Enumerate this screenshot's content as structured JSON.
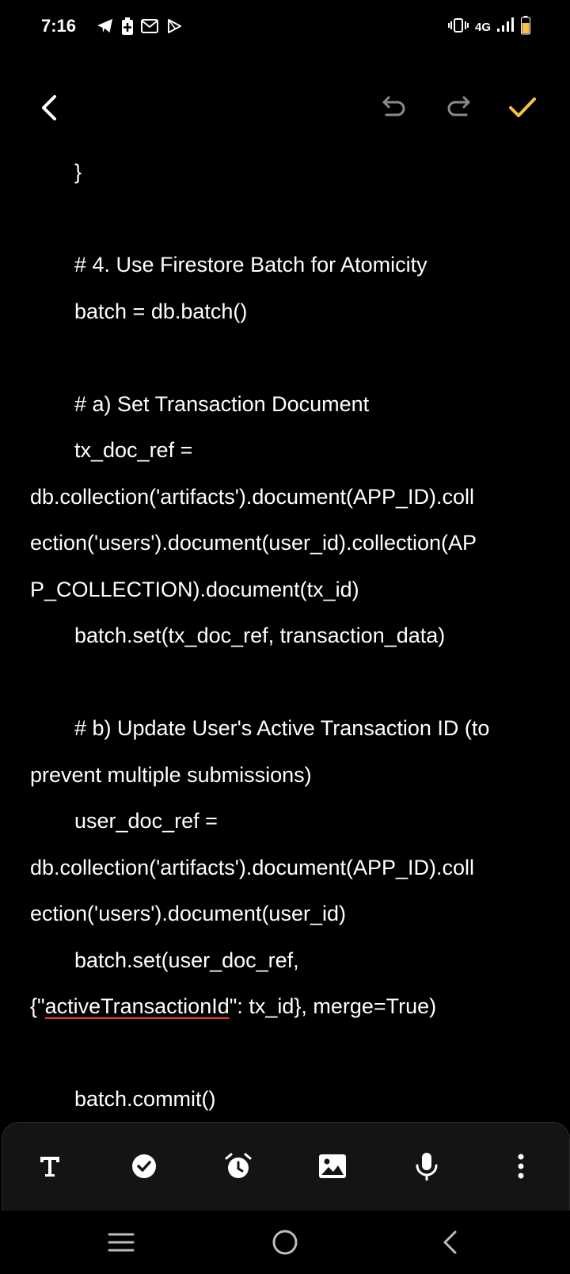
{
  "status_bar": {
    "time": "7:16",
    "left_icons": [
      "telegram-icon",
      "battery-saver-icon",
      "gmail-icon",
      "play-icon"
    ],
    "network": "4G",
    "right_icons": [
      "vibrate-icon",
      "signal-icon",
      "battery-icon"
    ],
    "battery_color": "#f5c242"
  },
  "top_toolbar": {
    "back_icon": "chevron-left-icon",
    "undo_icon": "undo-icon",
    "redo_icon": "redo-icon",
    "confirm_icon": "check-icon",
    "confirm_color": "#f5c242",
    "disabled_color": "#8a8a8a"
  },
  "editor": {
    "lines": [
      "}",
      "",
      "# 4. Use Firestore Batch for Atomicity",
      "batch = db.batch()",
      "",
      "# a) Set Transaction Document",
      "tx_doc_ref =",
      "db.collection('artifacts').document(APP_ID).coll",
      "ection('users').document(user_id).collection(AP",
      "P_COLLECTION).document(tx_id)",
      "batch.set(tx_doc_ref, transaction_data)",
      "",
      "# b) Update User's Active Transaction ID (to",
      "prevent multiple submissions)",
      "user_doc_ref =",
      "db.collection('artifacts').document(APP_ID).coll",
      "ection('users').document(user_id)",
      "batch.set(user_doc_ref,",
      "",
      "",
      "batch.commit()"
    ],
    "merge_line": {
      "prefix": "{\"",
      "underlined": "activeTransactionId",
      "suffix": "\": tx_id}, merge=True)"
    }
  },
  "bottom_toolbar": {
    "tools": [
      "text-format-icon",
      "checklist-icon",
      "alarm-icon",
      "image-icon",
      "mic-icon",
      "more-vertical-icon"
    ]
  },
  "nav_bar": {
    "icons": [
      "menu-icon",
      "home-icon",
      "back-icon"
    ]
  }
}
